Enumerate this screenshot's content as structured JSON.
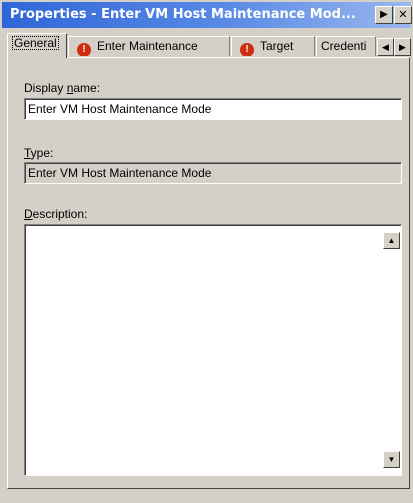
{
  "window": {
    "title": "Properties - Enter VM Host Maintenance Mod...",
    "arrow_button": "▶",
    "close_button": "✕"
  },
  "tabs": [
    {
      "label": "General",
      "active": true,
      "warning": false
    },
    {
      "label": "Enter Maintenance",
      "active": false,
      "warning": true
    },
    {
      "label": "Target",
      "active": false,
      "warning": true
    },
    {
      "label": "Credenti",
      "active": false,
      "warning": false
    }
  ],
  "tab_scroll": {
    "left": "◀",
    "right": "▶"
  },
  "form": {
    "display_name_label": {
      "accel": "Display ",
      "u": "n",
      "rest": "ame:"
    },
    "display_name_value": "Enter VM Host Maintenance Mode",
    "type_label": {
      "u": "T",
      "rest": "ype:"
    },
    "type_value": "Enter VM Host Maintenance Mode",
    "description_label": {
      "u": "D",
      "rest": "escription:"
    },
    "description_value": ""
  },
  "scrollbar": {
    "up": "▲",
    "down": "▼"
  },
  "icons": {
    "warning": "!"
  }
}
